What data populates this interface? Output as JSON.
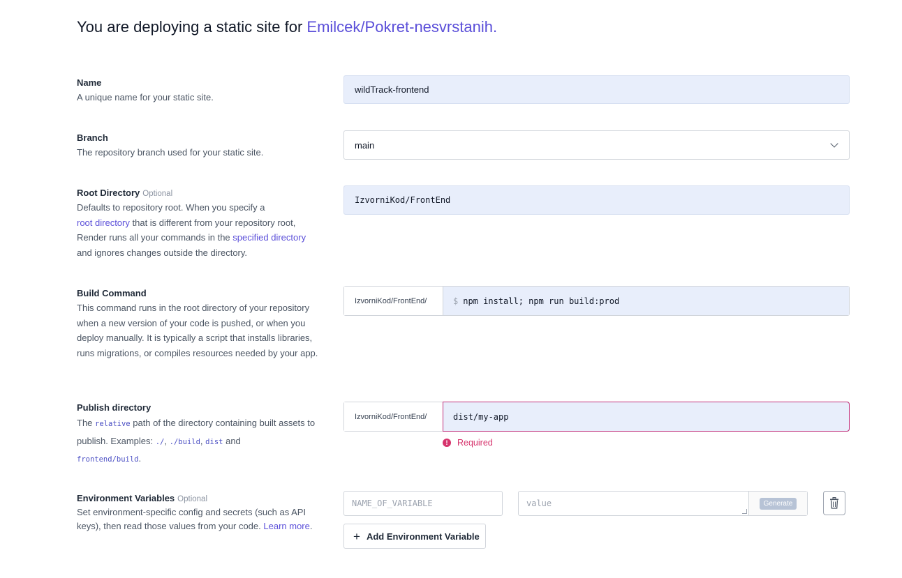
{
  "header": {
    "prefix": "You are deploying a static site for",
    "repo": "Emilcek/Pokret-nesvrstanih."
  },
  "name": {
    "label": "Name",
    "help": "A unique name for your static site.",
    "value": "wildTrack-frontend"
  },
  "branch": {
    "label": "Branch",
    "help": "The repository branch used for your static site.",
    "value": "main"
  },
  "root_directory": {
    "label": "Root Directory",
    "optional": "Optional",
    "help_1": "Defaults to repository root. When you specify a",
    "link_1": "root directory",
    "help_2": "that is different from your repository root,",
    "help_3": "Render runs all your commands in the",
    "link_2": "specified directory",
    "help_4": "and ignores changes outside the directory.",
    "value": "IzvorniKod/FrontEnd"
  },
  "build_command": {
    "label": "Build Command",
    "help": "This command runs in the root directory of your repository when a new version of your code is pushed, or when you deploy manually. It is typically a script that installs libraries, runs migrations, or compiles resources needed by your app.",
    "prefix": "IzvorniKod/FrontEnd/",
    "dollar": "$",
    "value": "npm install; npm run build:prod"
  },
  "publish_directory": {
    "label": "Publish directory",
    "help_the": "The",
    "code_relative": "relative",
    "help_mid": "path of the directory containing built assets to publish. Examples:",
    "ex_1": "./",
    "sep_1": ",",
    "ex_2": "./build",
    "sep_2": ",",
    "ex_3": "dist",
    "help_and": "and",
    "ex_4": "frontend/build",
    "help_end": ".",
    "prefix": "IzvorniKod/FrontEnd/",
    "value": "dist/my-app",
    "error": "Required"
  },
  "env_vars": {
    "label": "Environment Variables",
    "optional": "Optional",
    "help": "Set environment-specific config and secrets (such as API keys), then read those values from your code.",
    "link": "Learn more",
    "name_placeholder": "NAME_OF_VARIABLE",
    "value_placeholder": "value",
    "generate_label": "Generate",
    "add_label": "Add Environment Variable"
  },
  "icons": [
    "chevron-down-icon",
    "error-icon",
    "trash-icon",
    "plus-icon"
  ],
  "colors": {
    "accent": "#5b4fd9",
    "input_bg": "#e8eefb",
    "error": "#d6336c"
  }
}
